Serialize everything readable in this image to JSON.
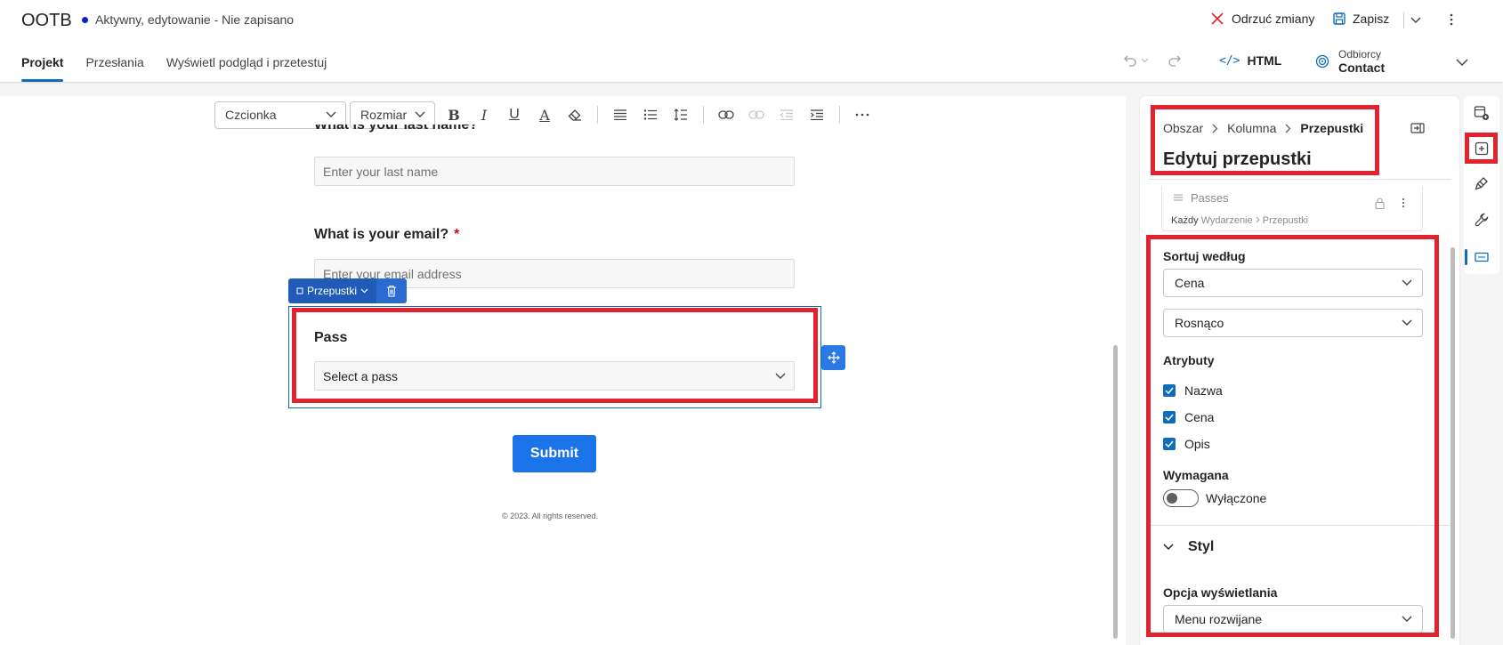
{
  "header": {
    "app_title": "OOTB",
    "status": "Aktywny, edytowanie - Nie zapisano",
    "discard_label": "Odrzuć zmiany",
    "save_label": "Zapisz",
    "tabs": [
      {
        "label": "Projekt",
        "active": true
      },
      {
        "label": "Przesłania",
        "active": false
      },
      {
        "label": "Wyświetl podgląd i przetestuj",
        "active": false
      }
    ],
    "html_label": "HTML",
    "audience_label": "Odbiorcy",
    "audience_value": "Contact"
  },
  "toolbar": {
    "font_placeholder": "Czcionka",
    "size_placeholder": "Rozmiar"
  },
  "form": {
    "last_name_question": "What is your last name?",
    "last_name_placeholder": "Enter your last name",
    "email_question": "What is your email?",
    "email_required_mark": "*",
    "email_placeholder": "Enter your email address",
    "selected_element_label": "Przepustki",
    "pass_label": "Pass",
    "pass_select_value": "Select a pass",
    "submit_label": "Submit",
    "footer_text": "© 2023. All rights reserved."
  },
  "panel": {
    "breadcrumb": [
      "Obszar",
      "Kolumna",
      "Przepustki"
    ],
    "title": "Edytuj przepustki",
    "passes_card": {
      "name": "Passes",
      "path_prefix": "Każdy",
      "path_entity": "Wydarzenie",
      "path_leaf": "Przepustki"
    },
    "sort_label": "Sortuj według",
    "sort_field": "Cena",
    "sort_order": "Rosnąco",
    "attributes_label": "Atrybuty",
    "attributes": [
      {
        "label": "Nazwa",
        "checked": true
      },
      {
        "label": "Cena",
        "checked": true
      },
      {
        "label": "Opis",
        "checked": true
      }
    ],
    "required_label": "Wymagana",
    "required_toggle_text": "Wyłączone",
    "style_section_label": "Styl",
    "display_option_label": "Opcja wyświetlania",
    "display_option_value": "Menu rozwijane"
  },
  "colors": {
    "accent": "#0f6cbd",
    "highlight_red": "#e0232f",
    "submit_blue": "#1a73e8"
  }
}
